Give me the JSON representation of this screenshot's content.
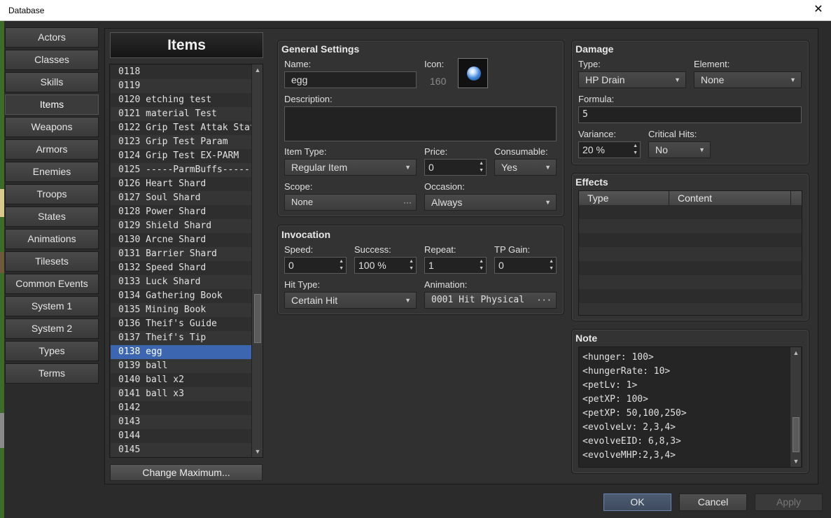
{
  "window": {
    "title": "Database",
    "close_glyph": "✕"
  },
  "tabs": [
    "Actors",
    "Classes",
    "Skills",
    "Items",
    "Weapons",
    "Armors",
    "Enemies",
    "Troops",
    "States",
    "Animations",
    "Tilesets",
    "Common Events",
    "System 1",
    "System 2",
    "Types",
    "Terms"
  ],
  "selected_tab": "Items",
  "list": {
    "header": "Items",
    "rows": [
      "0118 ",
      "0119 ",
      "0120 etching test",
      "0121 material Test",
      "0122 Grip Test Attak State",
      "0123 Grip Test Param",
      "0124 Grip Test EX-PARM",
      "0125 -----ParmBuffs-------",
      "0126 Heart Shard",
      "0127 Soul Shard",
      "0128 Power Shard",
      "0129 Shield Shard",
      "0130 Arcne Shard",
      "0131 Barrier Shard",
      "0132 Speed Shard",
      "0133 Luck Shard",
      "0134 Gathering Book",
      "0135 Mining Book",
      "0136 Theif's Guide",
      "0137 Theif's Tip",
      "0138 egg",
      "0139 ball",
      "0140 ball x2",
      "0141 ball x3",
      "0142 ",
      "0143 ",
      "0144 ",
      "0145 "
    ],
    "selected": "0138 egg",
    "change_max_label": "Change Maximum..."
  },
  "general": {
    "title": "General Settings",
    "name_label": "Name:",
    "name_value": "egg",
    "icon_label": "Icon:",
    "icon_index": "160",
    "icon_name": "blue-orb-icon",
    "description_label": "Description:",
    "description_value": "",
    "item_type_label": "Item Type:",
    "item_type_value": "Regular Item",
    "price_label": "Price:",
    "price_value": "0",
    "consumable_label": "Consumable:",
    "consumable_value": "Yes",
    "scope_label": "Scope:",
    "scope_value": "None",
    "occasion_label": "Occasion:",
    "occasion_value": "Always"
  },
  "invocation": {
    "title": "Invocation",
    "speed_label": "Speed:",
    "speed_value": "0",
    "success_label": "Success:",
    "success_value": "100 %",
    "repeat_label": "Repeat:",
    "repeat_value": "1",
    "tp_label": "TP Gain:",
    "tp_value": "0",
    "hit_type_label": "Hit Type:",
    "hit_type_value": "Certain Hit",
    "animation_label": "Animation:",
    "animation_value": "0001 Hit Physical"
  },
  "damage": {
    "title": "Damage",
    "type_label": "Type:",
    "type_value": "HP Drain",
    "element_label": "Element:",
    "element_value": "None",
    "formula_label": "Formula:",
    "formula_value": "5",
    "variance_label": "Variance:",
    "variance_value": "20 %",
    "critical_label": "Critical Hits:",
    "critical_value": "No"
  },
  "effects": {
    "title": "Effects",
    "col_type": "Type",
    "col_content": "Content"
  },
  "note": {
    "title": "Note",
    "lines": [
      "<hunger: 100>",
      "<hungerRate: 10>",
      "<petLv: 1>",
      "<petXP: 100>",
      "<petXP: 50,100,250>",
      "<evolveLv: 2,3,4>",
      "<evolveEID: 6,8,3>",
      "<evolveMHP:2,3,4>"
    ]
  },
  "buttons": {
    "ok": "OK",
    "cancel": "Cancel",
    "apply": "Apply"
  },
  "colors": {
    "accent": "#3c66b0",
    "panel": "#333333",
    "field": "#222222"
  }
}
